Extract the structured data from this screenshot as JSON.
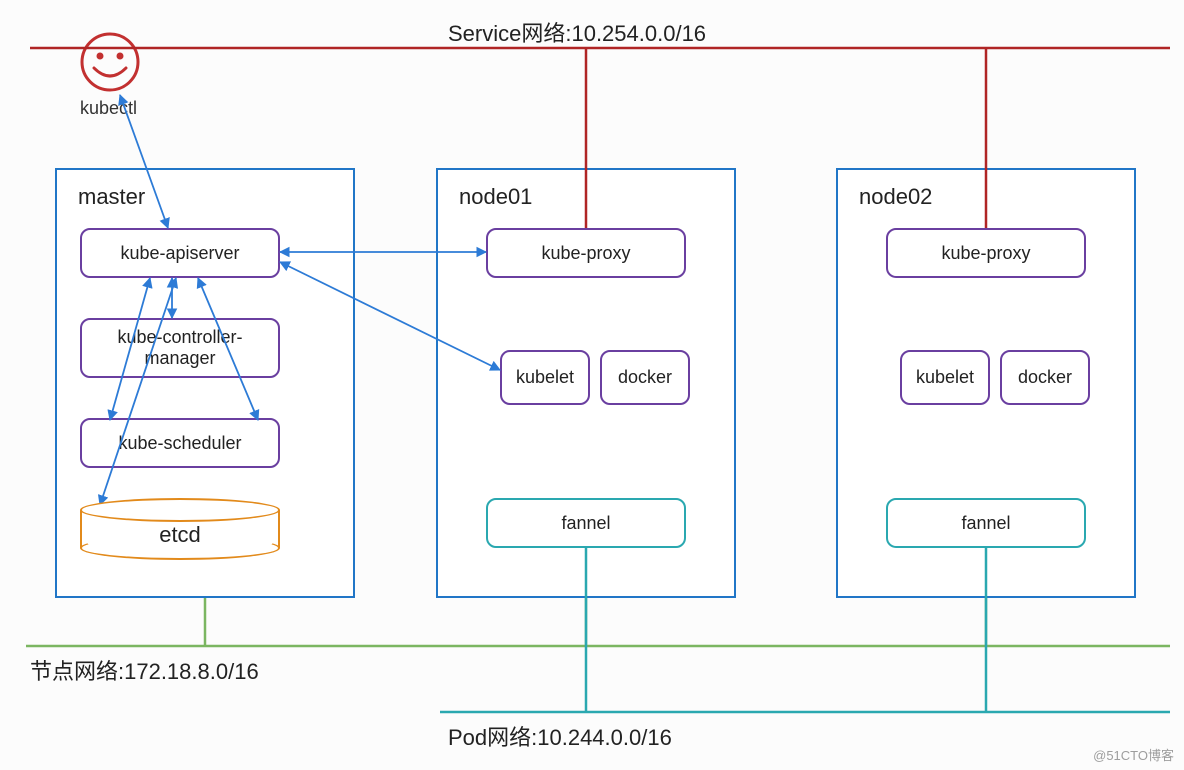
{
  "service_network_label": "Service网络:10.254.0.0/16",
  "node_network_label": "节点网络:172.18.8.0/16",
  "pod_network_label": "Pod网络:10.244.0.0/16",
  "kubectl_label": "kubectl",
  "master": {
    "title": "master",
    "apiserver": "kube-apiserver",
    "controller": "kube-controller-manager",
    "scheduler": "kube-scheduler",
    "etcd": "etcd"
  },
  "node01": {
    "title": "node01",
    "proxy": "kube-proxy",
    "kubelet": "kubelet",
    "docker": "docker",
    "fannel": "fannel"
  },
  "node02": {
    "title": "node02",
    "proxy": "kube-proxy",
    "kubelet": "kubelet",
    "docker": "docker",
    "fannel": "fannel"
  },
  "watermark": "@51CTO博客"
}
